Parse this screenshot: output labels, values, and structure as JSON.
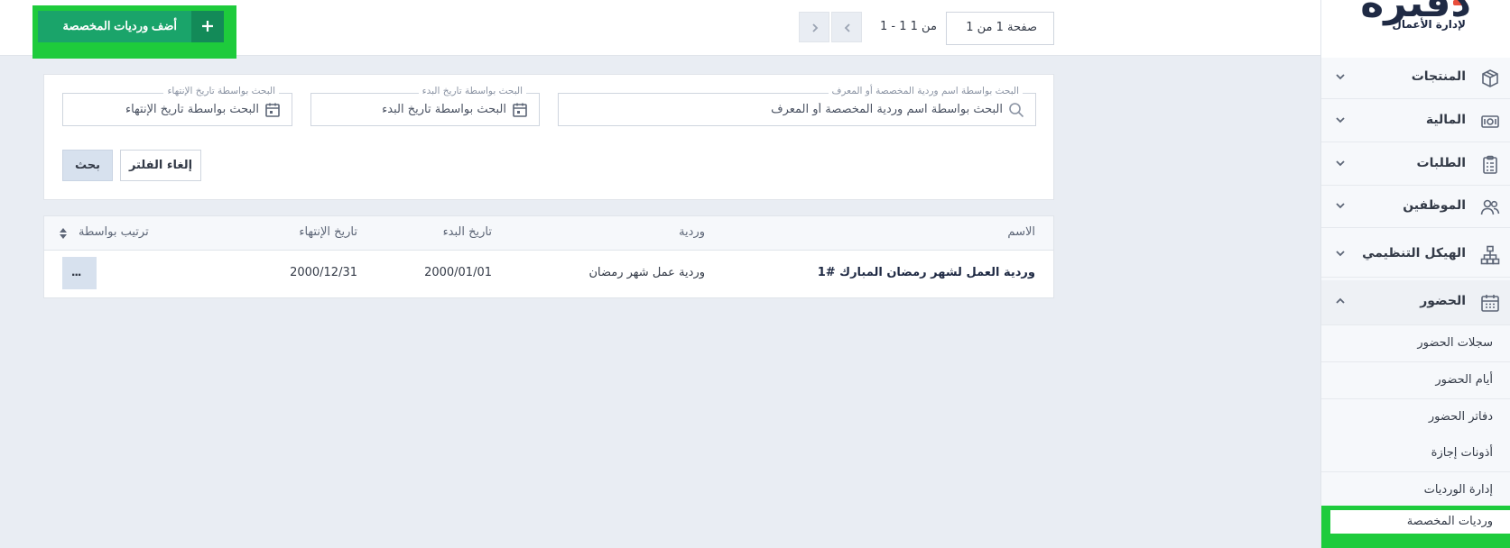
{
  "brand": {
    "logo_text": "دفترة",
    "tagline": "لإدارة الأعمال",
    "accent_color": "#e94e3c"
  },
  "colors": {
    "primary": "#1aa46a",
    "highlight": "#1ecb3c",
    "page_bg": "#e9edf3"
  },
  "sidebar": {
    "items": [
      {
        "label": "المنتجات",
        "icon": "box-icon",
        "expanded": false
      },
      {
        "label": "المالية",
        "icon": "money-icon",
        "expanded": false
      },
      {
        "label": "الطلبات",
        "icon": "clipboard-icon",
        "expanded": false
      },
      {
        "label": "الموظفين",
        "icon": "people-icon",
        "expanded": false
      },
      {
        "label": "الهيكل التنظيمي",
        "icon": "org-chart-icon",
        "expanded": false
      },
      {
        "label": "الحضور",
        "icon": "calendar-icon",
        "expanded": true
      }
    ],
    "sub_items": [
      {
        "label": "سجلات الحضور"
      },
      {
        "label": "أيام الحضور"
      },
      {
        "label": "دفاتر الحضور"
      },
      {
        "label": "أذونات إجازة"
      },
      {
        "label": "إدارة الورديات"
      },
      {
        "label": "ورديات المخصصة",
        "active": true
      }
    ]
  },
  "toolbar": {
    "add_label": "أضف ورديات المخصصة",
    "pagination_count": "1 - 1 من 1",
    "page_select": "صفحة 1 من 1"
  },
  "filters": {
    "name": {
      "legend": "البحث بواسطة اسم وردية المخصصة أو المعرف",
      "placeholder": "البحث بواسطة اسم وردية المخصصة أو المعرف"
    },
    "start_date": {
      "legend": "البحث بواسطة تاريخ البدء",
      "placeholder": "البحث بواسطة تاريخ البدء"
    },
    "end_date": {
      "legend": "البحث بواسطة تاريخ الإنتهاء",
      "placeholder": "البحث بواسطة تاريخ الإنتهاء"
    },
    "reset_label": "إلغاء الفلتر",
    "search_label": "بحث"
  },
  "table": {
    "headers": {
      "name": "الاسم",
      "shift": "وردية",
      "start": "تاريخ البدء",
      "end": "تاريخ الإنتهاء",
      "sort": "ترتيب بواسطة"
    },
    "rows": [
      {
        "name": "وردية العمل لشهر رمضان المبارك #1",
        "shift": "وردية عمل شهر رمضان",
        "start": "2000/01/01",
        "end": "2000/12/31",
        "menu": "..."
      }
    ]
  }
}
